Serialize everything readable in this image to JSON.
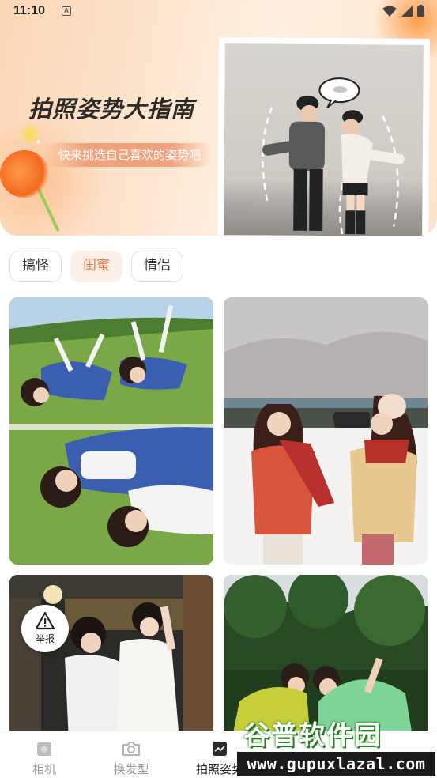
{
  "status_bar": {
    "time": "11:10",
    "indicator": "A"
  },
  "banner": {
    "title": "拍照姿势大指南",
    "subtitle": "快来挑选自己喜欢的姿势吧"
  },
  "tabs": [
    {
      "label": "搞怪",
      "active": false
    },
    {
      "label": "闺蜜",
      "active": true
    },
    {
      "label": "情侣",
      "active": false
    }
  ],
  "report": {
    "label": "举报",
    "icon": "warning-icon"
  },
  "bottom_nav": [
    {
      "label": "相机",
      "icon": "camera-body-icon",
      "active": false
    },
    {
      "label": "换发型",
      "icon": "camera-icon",
      "active": false
    },
    {
      "label": "拍照姿势",
      "icon": "pose-icon",
      "active": true
    }
  ],
  "watermark": {
    "brand": "谷普软件园",
    "url": "www.gupuxlazal.com"
  },
  "colors": {
    "accent": "#e97d4c",
    "active_tab_bg": "#fdf0e8"
  }
}
